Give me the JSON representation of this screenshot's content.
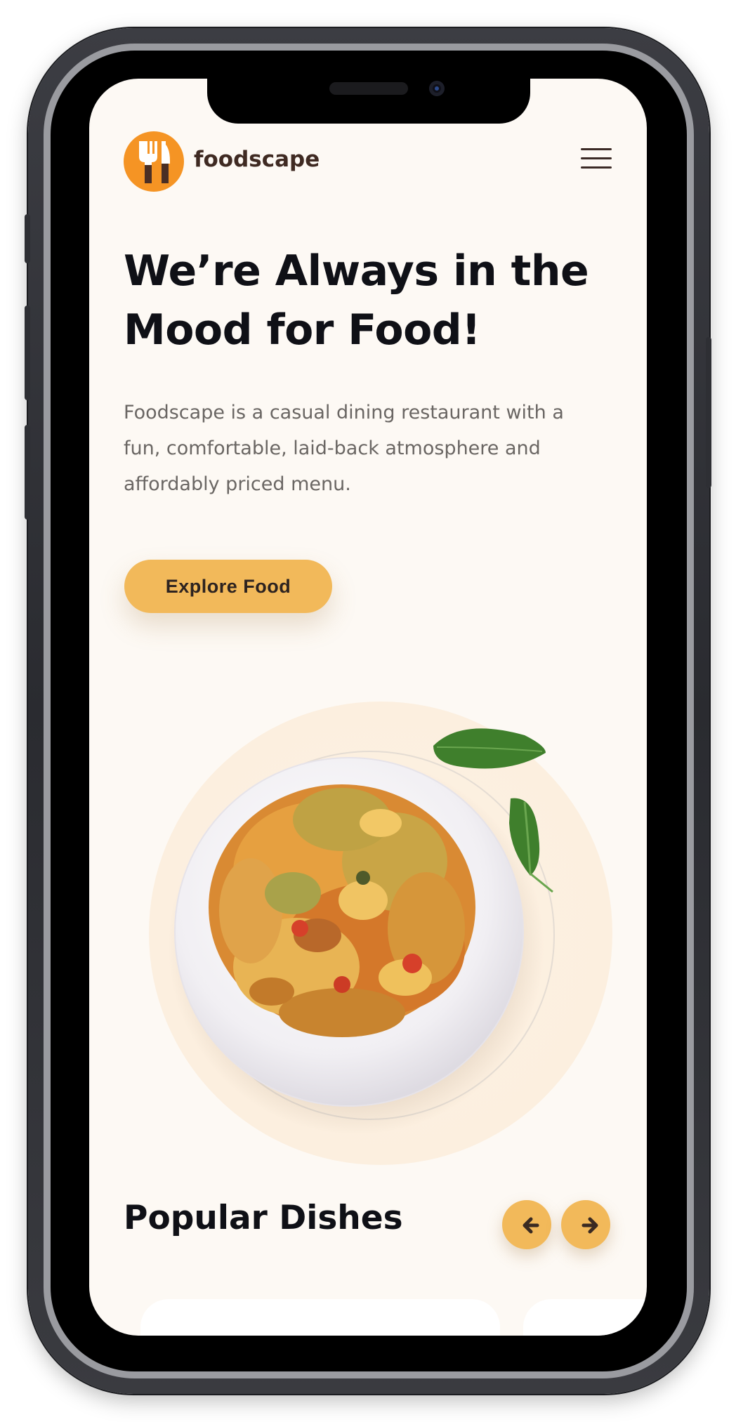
{
  "brand": {
    "name": "foodscape",
    "logo_color": "#f59424"
  },
  "header": {
    "menu_icon": "hamburger-menu-icon"
  },
  "hero": {
    "title_line1": "We’re Always in the",
    "title_line2": "Mood for Food!",
    "description_line1": "Foodscape is a casual dining restaurant with a",
    "description_line2": "fun, comfortable, laid-back atmosphere and",
    "description_line3": "affordably priced menu.",
    "cta_label": "Explore Food",
    "image": "pasta-plate-with-basil-image"
  },
  "popular": {
    "title": "Popular Dishes",
    "prev_icon": "arrow-left-icon",
    "next_icon": "arrow-right-icon"
  },
  "colors": {
    "background": "#fdf9f4",
    "accent": "#f2b95a",
    "text_dark": "#0f1016",
    "text_muted": "#6a6663"
  }
}
